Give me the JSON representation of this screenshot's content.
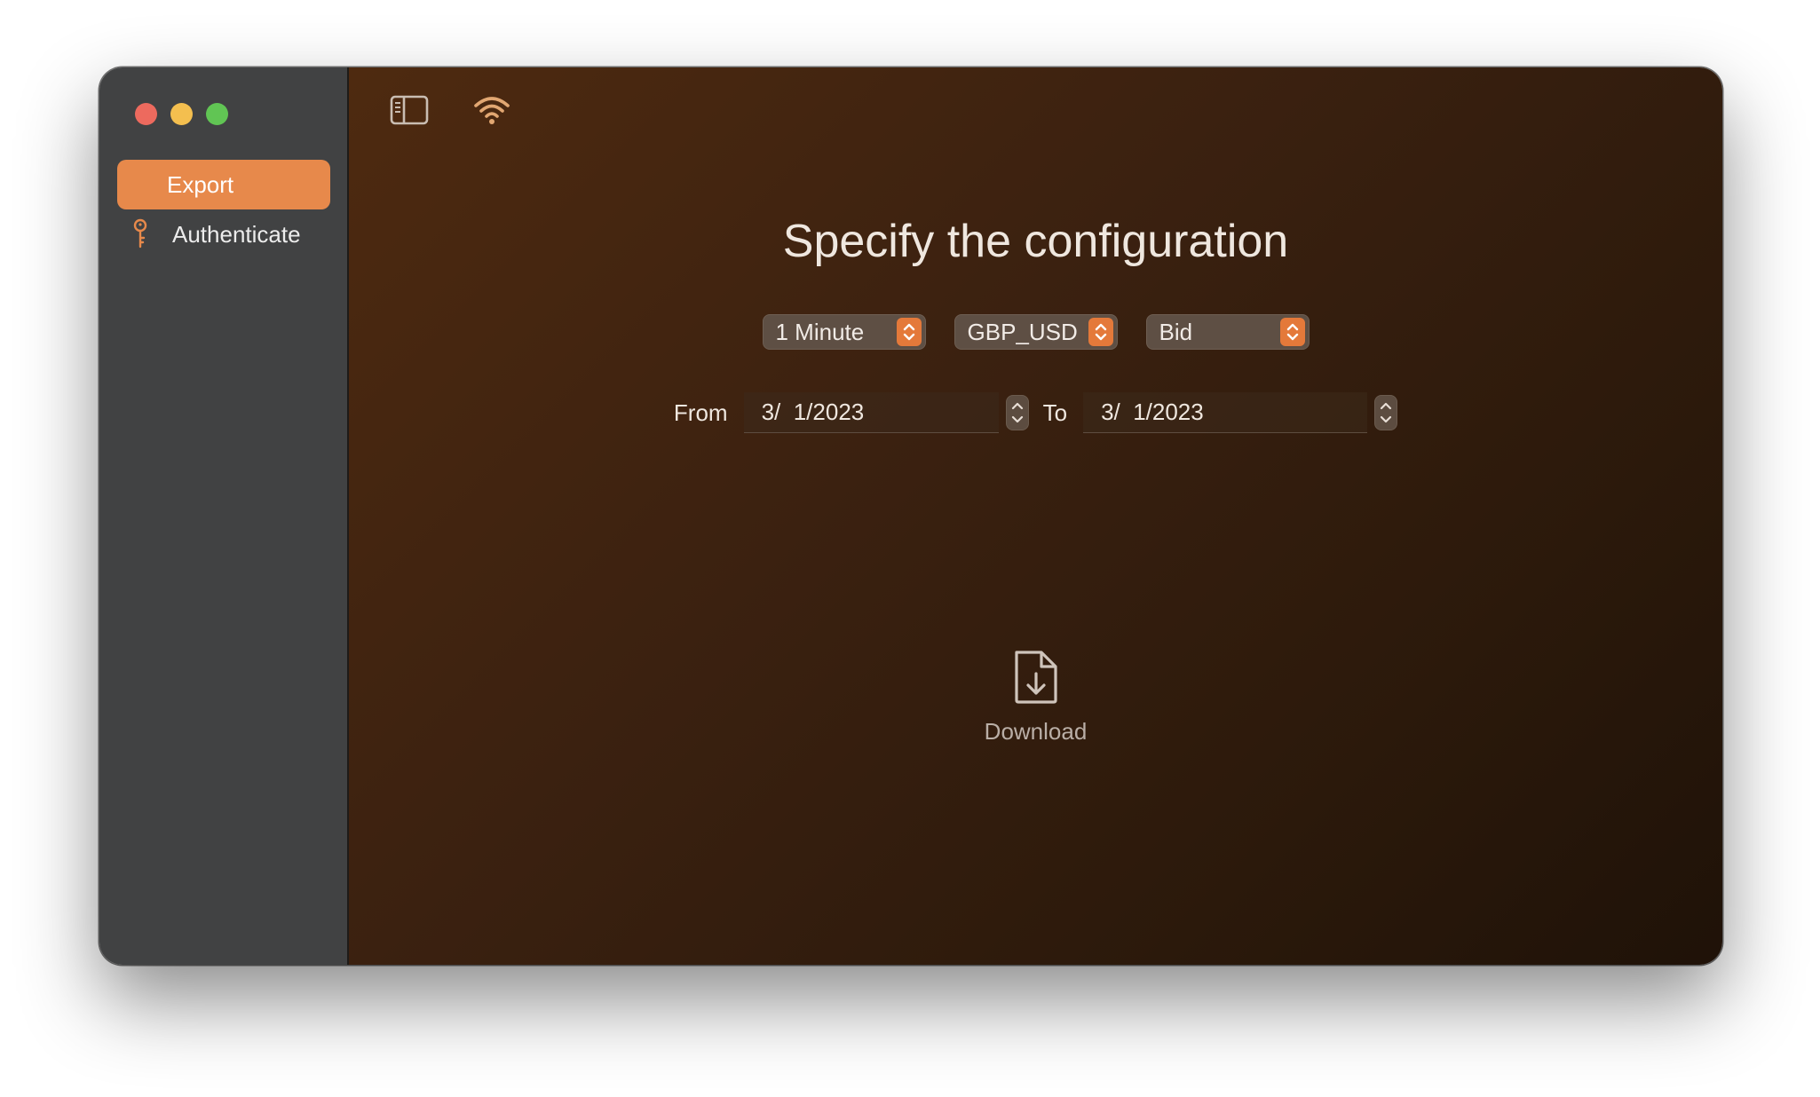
{
  "sidebar": {
    "items": [
      {
        "label": "Export",
        "active": true
      },
      {
        "label": "Authenticate",
        "icon": "key-icon"
      }
    ]
  },
  "toolbar": {
    "icons": [
      "sidebar-toggle-icon",
      "wifi-icon"
    ]
  },
  "main": {
    "heading": "Specify the configuration",
    "popups": [
      {
        "name": "timeframe",
        "value": "1 Minute"
      },
      {
        "name": "instrument",
        "value": "GBP_USD"
      },
      {
        "name": "price-type",
        "value": "Bid"
      }
    ],
    "dates": {
      "from_label": "From",
      "from_value": "3/  1/2023",
      "to_label": "To",
      "to_value": "3/  1/2023"
    },
    "download_label": "Download"
  },
  "colors": {
    "accent": "#e7894b",
    "popup_chevron": "#e4793a",
    "sidebar_bg": "#414243",
    "main_bg_start": "#4e2a10",
    "main_bg_end": "#1f1208"
  }
}
